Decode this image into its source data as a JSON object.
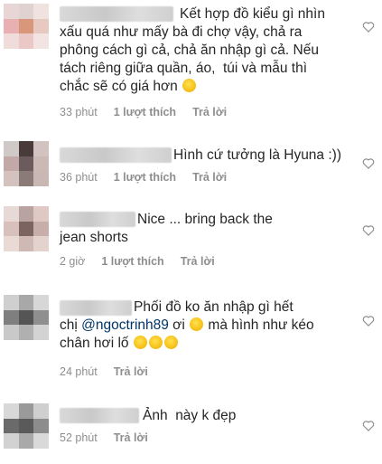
{
  "comments": [
    {
      "text_lines": [
        "Kết hợp đồ kiểu gì nhìn",
        "xấu quá như mấy bà đi chợ vậy, chả ra",
        "phông cách gì cả, chả ăn nhập gì cả. Nếu",
        "tách riêng giữa quần, áo,  túi và mẫu thì",
        "chắc sẽ có giá hơn"
      ],
      "time": "33 phút",
      "likes": "1 lượt thích",
      "reply": "Trả lời",
      "avatar_colors": [
        "#e8d6d6",
        "#e0d2d0",
        "#efe2df",
        "#e9b0b3",
        "#d8967a",
        "#e7c9c2",
        "#f0dcda",
        "#e9c8c6",
        "#f2e4e2"
      ]
    },
    {
      "text_lines": [
        "Hình cứ tưởng là Hyuna :))"
      ],
      "time": "36 phút",
      "likes": "1 lượt thích",
      "reply": "Trả lời",
      "avatar_colors": [
        "#cfcac8",
        "#4a3b3b",
        "#d2c3c1",
        "#c2a8a6",
        "#6b5b5c",
        "#cbb9b5",
        "#d4c2bf",
        "#8a7a78",
        "#c9b7b3"
      ]
    },
    {
      "text_lines": [
        "Nice ... bring back the",
        "jean shorts"
      ],
      "time": "2 giờ",
      "likes": "1 lượt thích",
      "reply": "Trả lời",
      "avatar_colors": [
        "#e6d9d6",
        "#b9a3a0",
        "#e0c8c4",
        "#d8c0bd",
        "#7c6461",
        "#c8aeaa",
        "#eadad6",
        "#d0b8b4",
        "#e4d2ce"
      ]
    },
    {
      "line1": "Phối đồ ko ăn nhập gì hết",
      "line2_prefix": "chị ",
      "mention": "@ngoctrinh89",
      "line2_suffix": " ơi",
      "line2_after_emoji": " mà hình như kéo",
      "line3": "chân hơi lố",
      "time": "24 phút",
      "reply": "Trả lời",
      "avatar_colors": [
        "#cfcfcf",
        "#a8a8a8",
        "#d7d7d7",
        "#7f7f7f",
        "#555555",
        "#8f8f8f",
        "#c9c9c9",
        "#b0b0b0",
        "#d3d3d3"
      ]
    },
    {
      "text_lines": [
        "Ảnh  này k đẹp"
      ],
      "time": "52 phút",
      "reply": "Trả lời",
      "avatar_colors": [
        "#d8d8d8",
        "#9a9a9a",
        "#cfcfcf",
        "#6a6a6a",
        "#5a5a5a",
        "#8c8c8c",
        "#d2d2d2",
        "#a9a9a9",
        "#d9d9d9"
      ]
    }
  ],
  "icons": {
    "heart": "heart-outline-icon",
    "emoji": "emoji-icon"
  }
}
